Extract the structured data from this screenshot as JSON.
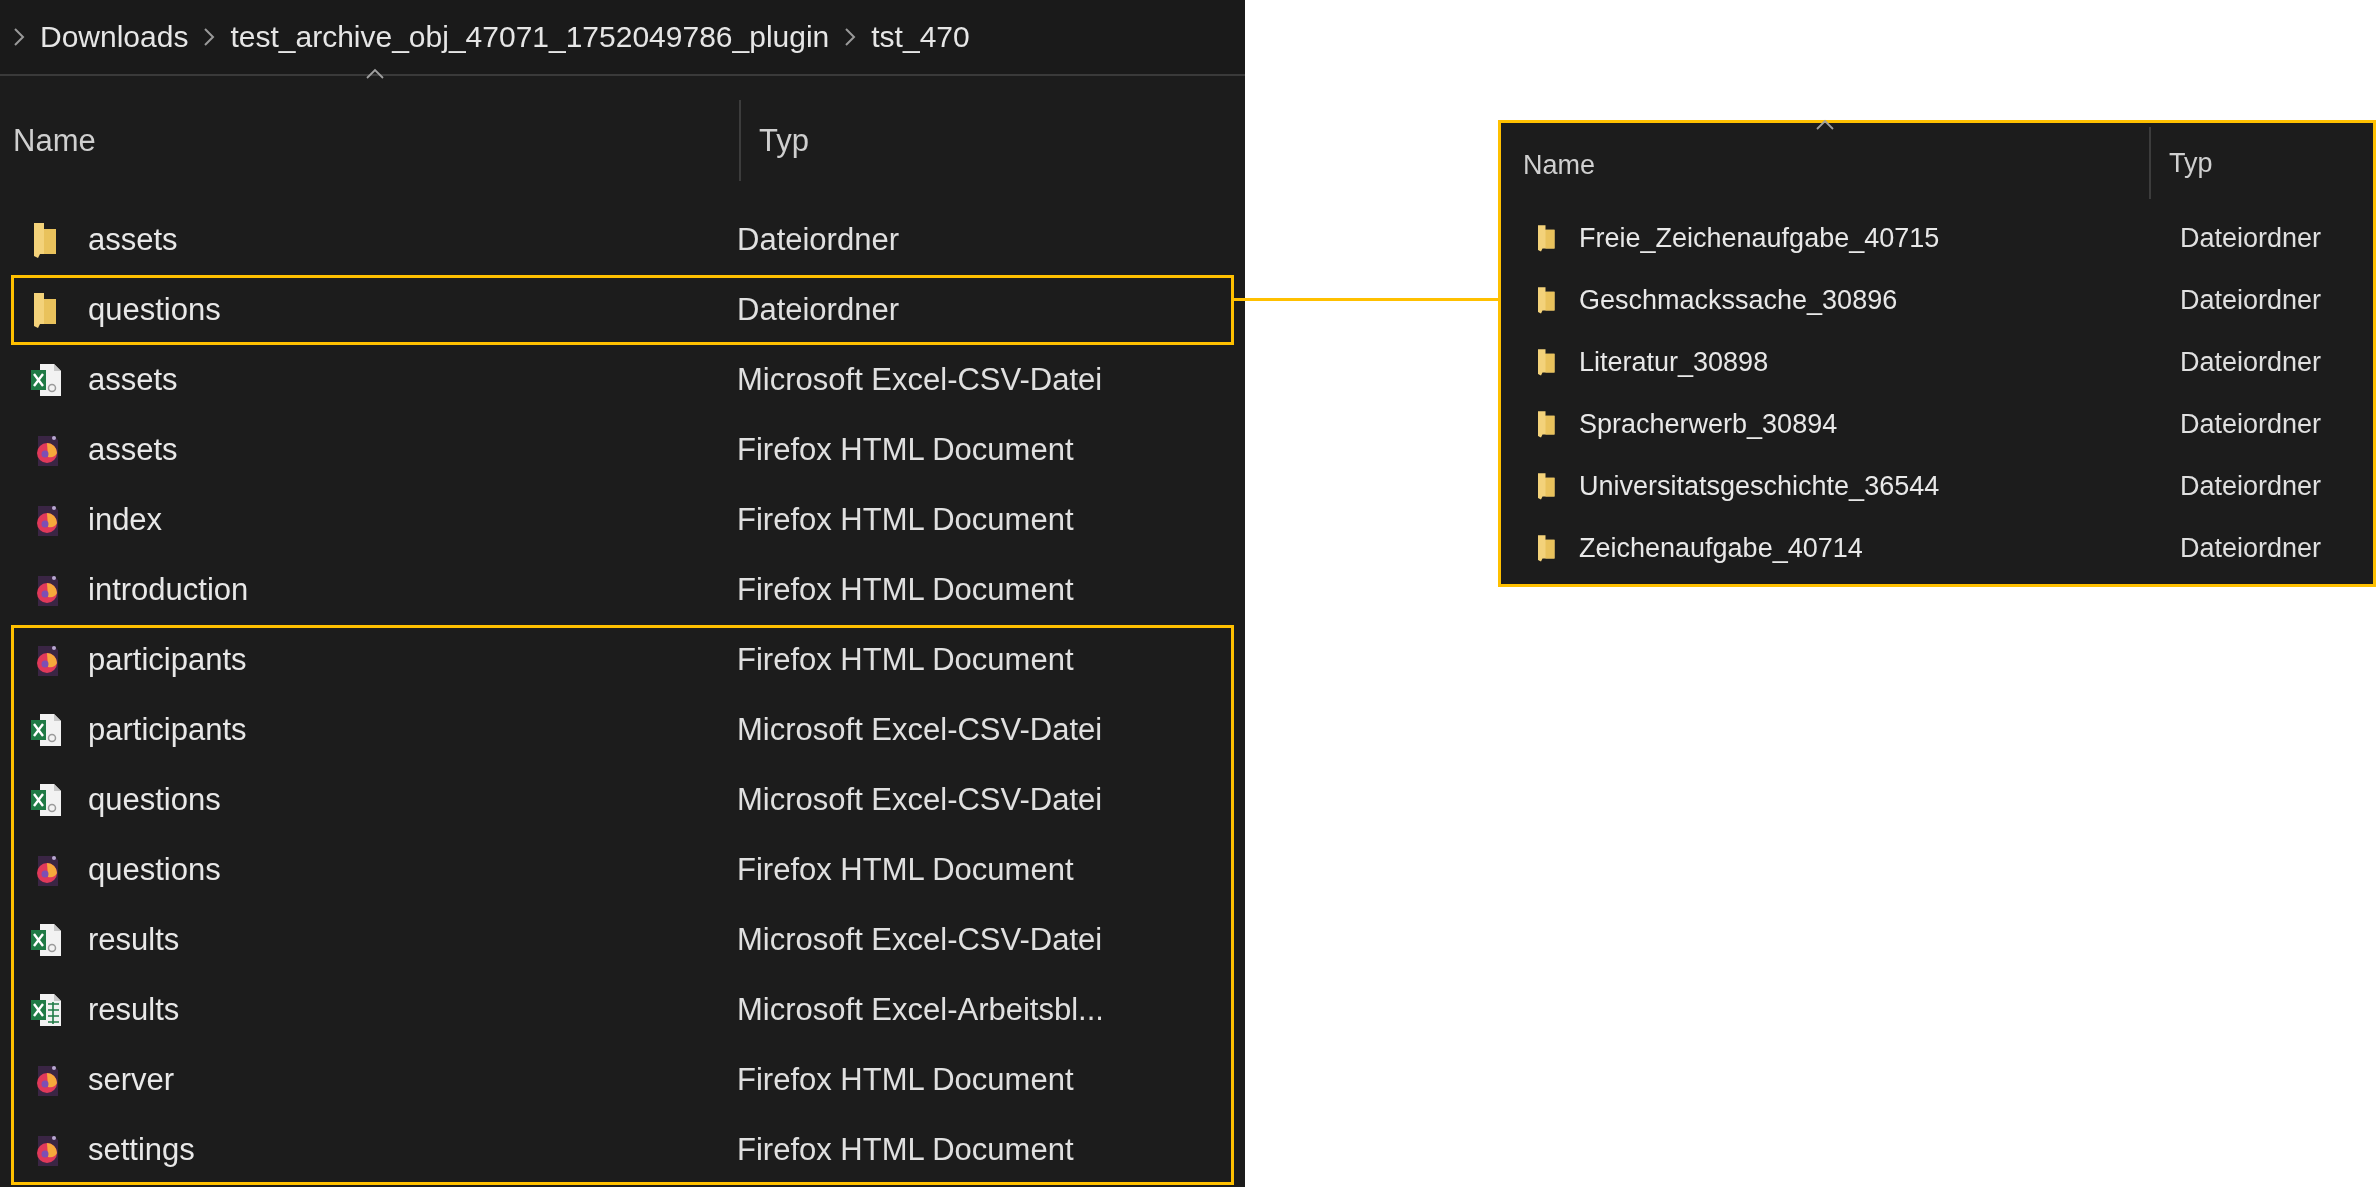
{
  "breadcrumb": [
    {
      "label": "Downloads"
    },
    {
      "label": "test_archive_obj_47071_1752049786_plugin"
    },
    {
      "label": "tst_470"
    }
  ],
  "file_list": {
    "columns": [
      {
        "label": "Name",
        "sorted": true
      },
      {
        "label": "Typ",
        "sorted": false
      }
    ],
    "groups": [
      {
        "highlighted": false,
        "rows": [
          {
            "name": "assets",
            "type": "Dateiordner",
            "kind": "folder"
          }
        ]
      },
      {
        "highlighted": true,
        "rows": [
          {
            "name": "questions",
            "type": "Dateiordner",
            "kind": "folder"
          }
        ]
      },
      {
        "highlighted": false,
        "rows": [
          {
            "name": "assets",
            "type": "Microsoft Excel-CSV-Datei",
            "kind": "csv"
          },
          {
            "name": "assets",
            "type": "Firefox HTML Document",
            "kind": "html"
          },
          {
            "name": "index",
            "type": "Firefox HTML Document",
            "kind": "html"
          },
          {
            "name": "introduction",
            "type": "Firefox HTML Document",
            "kind": "html"
          }
        ]
      },
      {
        "highlighted": true,
        "rows": [
          {
            "name": "participants",
            "type": "Firefox HTML Document",
            "kind": "html"
          },
          {
            "name": "participants",
            "type": "Microsoft Excel-CSV-Datei",
            "kind": "csv"
          },
          {
            "name": "questions",
            "type": "Microsoft Excel-CSV-Datei",
            "kind": "csv"
          },
          {
            "name": "questions",
            "type": "Firefox HTML Document",
            "kind": "html"
          },
          {
            "name": "results",
            "type": "Microsoft Excel-CSV-Datei",
            "kind": "csv"
          },
          {
            "name": "results",
            "type": "Microsoft Excel-Arbeitsbl...",
            "kind": "xlsx"
          },
          {
            "name": "server",
            "type": "Firefox HTML Document",
            "kind": "html"
          },
          {
            "name": "settings",
            "type": "Firefox HTML Document",
            "kind": "html"
          }
        ]
      }
    ]
  },
  "detail_list": {
    "columns": [
      {
        "label": "Name",
        "sorted": true
      },
      {
        "label": "Typ",
        "sorted": false
      }
    ],
    "rows": [
      {
        "name": "Freie_Zeichenaufgabe_40715",
        "type": "Dateiordner",
        "kind": "folder"
      },
      {
        "name": "Geschmackssache_30896",
        "type": "Dateiordner",
        "kind": "folder"
      },
      {
        "name": "Literatur_30898",
        "type": "Dateiordner",
        "kind": "folder"
      },
      {
        "name": "Spracherwerb_30894",
        "type": "Dateiordner",
        "kind": "folder"
      },
      {
        "name": "Universitatsgeschichte_36544",
        "type": "Dateiordner",
        "kind": "folder"
      },
      {
        "name": "Zeichenaufgabe_40714",
        "type": "Dateiordner",
        "kind": "folder"
      }
    ]
  }
}
